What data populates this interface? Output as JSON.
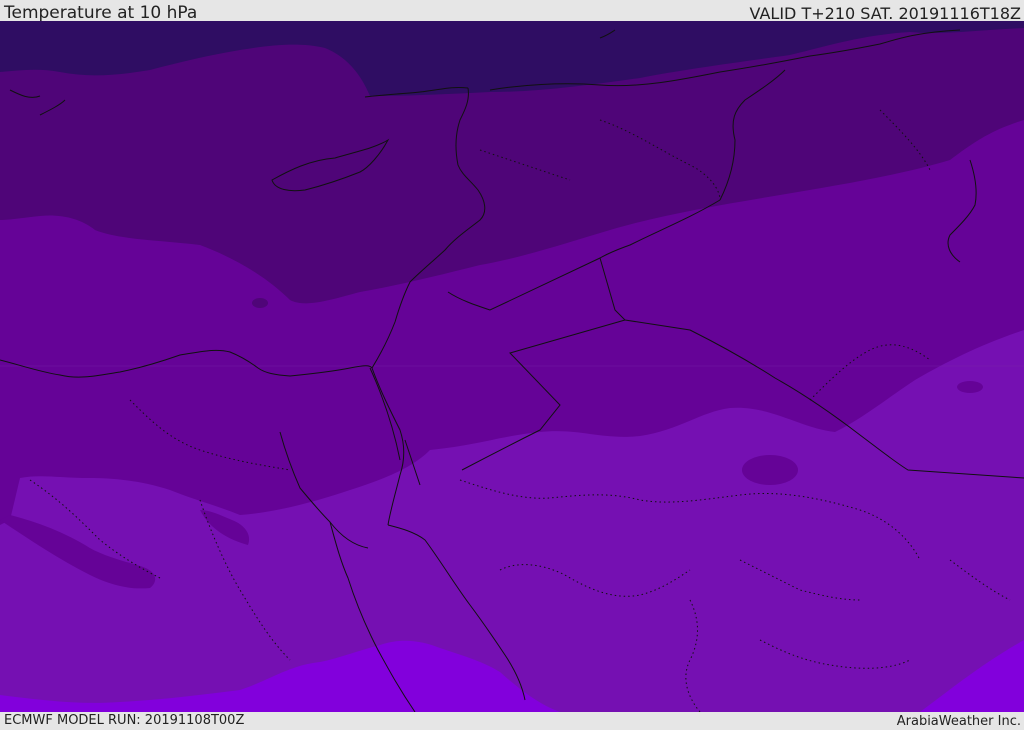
{
  "header": {
    "title": "Temperature at 10 hPa",
    "valid": "VALID T+210 SAT. 20191116T18Z"
  },
  "footer": {
    "model_run": "ECMWF MODEL RUN: 20191108T00Z",
    "credit": "ArabiaWeather Inc."
  },
  "palette": {
    "band_darkest": "#2f0d63",
    "band_dark": "#4f0578",
    "band_mid": "#650397",
    "band_light": "#7510b2",
    "band_lightest": "#8200dc",
    "border_line": "#111111"
  }
}
